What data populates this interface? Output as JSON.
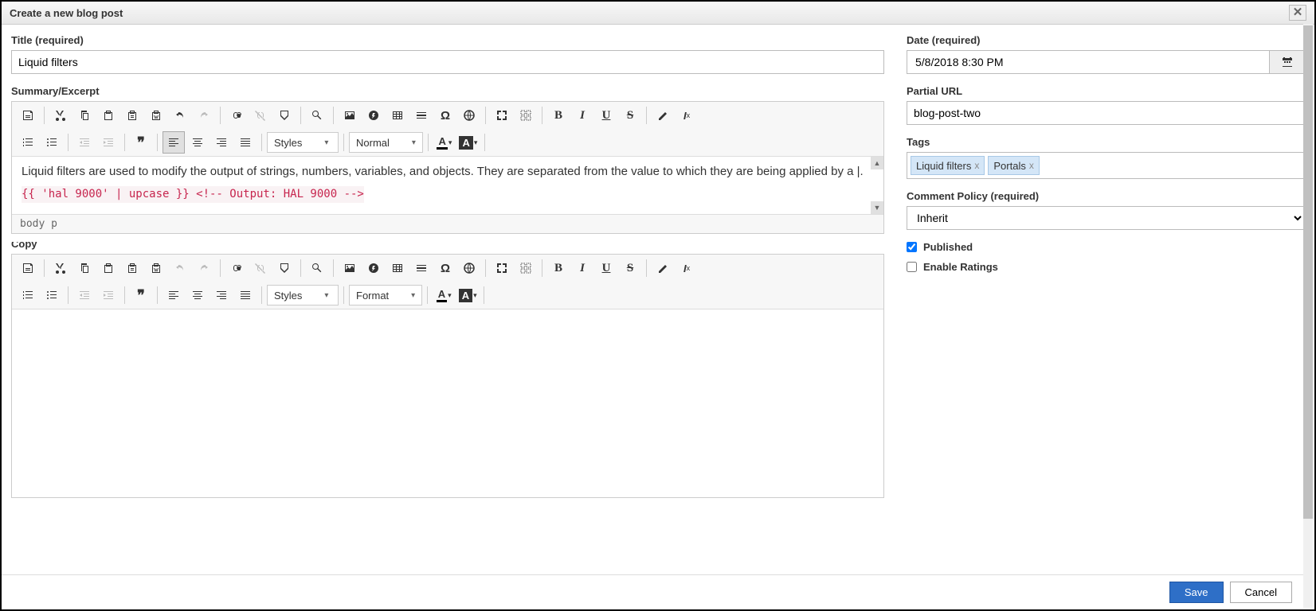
{
  "dialog": {
    "title": "Create a new blog post",
    "close_glyph": "✕"
  },
  "fields": {
    "title_label": "Title (required)",
    "title_value": "Liquid filters",
    "summary_label": "Summary/Excerpt",
    "summary_text": "Liquid filters are used to modify the output of strings, numbers, variables, and objects. They are separated from the value to which they are being applied by a |.",
    "summary_code": "{{ 'hal 9000' | upcase }} <!-- Output: HAL 9000 -->",
    "summary_path": "body  p",
    "copy_label": "Copy",
    "date_label": "Date (required)",
    "date_value": "5/8/2018 8:30 PM",
    "partial_url_label": "Partial URL",
    "partial_url_value": "blog-post-two",
    "tags_label": "Tags",
    "tags": [
      "Liquid filters",
      "Portals"
    ],
    "comment_policy_label": "Comment Policy (required)",
    "comment_policy_value": "Inherit",
    "published_label": "Published",
    "published_checked": true,
    "ratings_label": "Enable Ratings",
    "ratings_checked": false
  },
  "editor": {
    "styles_label": "Styles",
    "format_normal": "Normal",
    "format_label": "Format"
  },
  "footer": {
    "save": "Save",
    "cancel": "Cancel"
  }
}
